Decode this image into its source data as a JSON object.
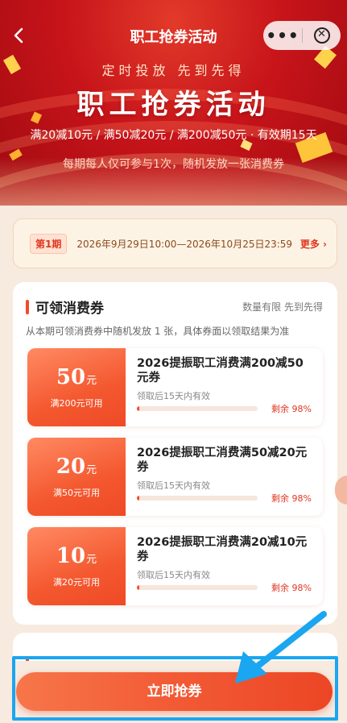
{
  "nav": {
    "back_icon": "chevron-left-icon",
    "title": "职工抢券活动",
    "more_icon": "more-dots-icon",
    "close_icon": "close-circle-icon"
  },
  "hero": {
    "subtitle": "定时投放  先到先得",
    "title": "职工抢券活动",
    "rules": "满20减10元 / 满50减20元 / 满200减50元 · 有效期15天",
    "limit": "每期每人仅可参与1次，随机发放一张消费券"
  },
  "period": {
    "tag": "第1期",
    "range": "2026年9月29日10:00—2026年10月25日23:59",
    "more": "更多 ›"
  },
  "section": {
    "title": "可领消费券",
    "note": "数量有限 先到先得",
    "desc": "从本期可领消费券中随机发放 1 张，具体券面以领取结果为准"
  },
  "coupons": [
    {
      "amount": "50",
      "unit": "元",
      "cond": "满200元可用",
      "name": "2026提振职工消费满200减50元券",
      "valid": "领取后15天内有效",
      "remain": "剩余 98%",
      "remain_ratio": 0.98
    },
    {
      "amount": "20",
      "unit": "元",
      "cond": "满50元可用",
      "name": "2026提振职工消费满50减20元券",
      "valid": "领取后15天内有效",
      "remain": "剩余 98%",
      "remain_ratio": 0.98
    },
    {
      "amount": "10",
      "unit": "元",
      "cond": "满20元可用",
      "name": "2026提振职工消费满20减10元券",
      "valid": "领取后15天内有效",
      "remain": "剩余 98%",
      "remain_ratio": 0.98
    }
  ],
  "bottom": {
    "button": "立即抢券"
  },
  "colors": {
    "accent": "#f24b2b",
    "highlight": "#1aa6f0"
  }
}
